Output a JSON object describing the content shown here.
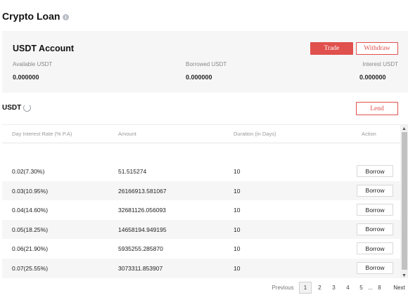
{
  "page": {
    "title": "Crypto Loan"
  },
  "account": {
    "title": "USDT Account",
    "trade_label": "Trade",
    "withdraw_label": "Withdraw",
    "stats": [
      {
        "label": "Available USDT",
        "value": "0.000000"
      },
      {
        "label": "Borrowed USDT",
        "value": "0.000000"
      },
      {
        "label": "Interest USDT",
        "value": "0.000000"
      }
    ]
  },
  "loans": {
    "currency": "USDT",
    "lend_label": "Lend",
    "columns": [
      "Day Interest Rate (% P.A)",
      "Amount",
      "Duration (in Days)",
      "Action"
    ],
    "rows": [
      {
        "rate": "0.02(7.30%)",
        "amount": "51.515274",
        "duration": "10",
        "action": "Borrow"
      },
      {
        "rate": "0.03(10.95%)",
        "amount": "26166913.581067",
        "duration": "10",
        "action": "Borrow"
      },
      {
        "rate": "0.04(14.60%)",
        "amount": "32681126.056093",
        "duration": "10",
        "action": "Borrow"
      },
      {
        "rate": "0.05(18.25%)",
        "amount": "14658194.949195",
        "duration": "10",
        "action": "Borrow"
      },
      {
        "rate": "0.06(21.90%)",
        "amount": "5935255.285870",
        "duration": "10",
        "action": "Borrow"
      },
      {
        "rate": "0.07(25.55%)",
        "amount": "3073311.853907",
        "duration": "10",
        "action": "Borrow"
      }
    ]
  },
  "pagination": {
    "prev_label": "Previous",
    "pages": [
      "1",
      "2",
      "3",
      "4",
      "5",
      "...",
      "8"
    ],
    "current": "1",
    "next_label": "Next"
  },
  "colors": {
    "accent": "#e0504d",
    "card_bg": "#f6f6f7"
  }
}
